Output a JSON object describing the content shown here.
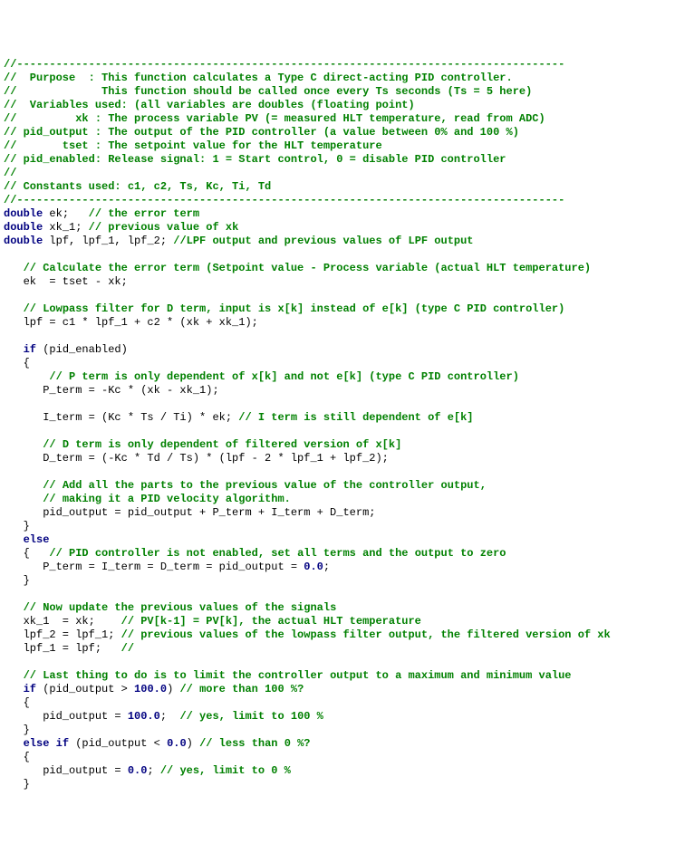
{
  "lines": [
    [
      {
        "cls": "c",
        "t": "//------------------------------------------------------------------------------------"
      }
    ],
    [
      {
        "cls": "c",
        "t": "//  Purpose  : This function calculates a Type C direct-acting PID controller."
      }
    ],
    [
      {
        "cls": "c",
        "t": "//             This function should be called once every Ts seconds (Ts = 5 here)"
      }
    ],
    [
      {
        "cls": "c",
        "t": "//  Variables used: (all variables are doubles (floating point)"
      }
    ],
    [
      {
        "cls": "c",
        "t": "//         xk : The process variable PV (= measured HLT temperature, read from ADC)"
      }
    ],
    [
      {
        "cls": "c",
        "t": "// pid_output : The output of the PID controller (a value between 0% and 100 %)"
      }
    ],
    [
      {
        "cls": "c",
        "t": "//       tset : The setpoint value for the HLT temperature"
      }
    ],
    [
      {
        "cls": "c",
        "t": "// pid_enabled: Release signal: 1 = Start control, 0 = disable PID controller"
      }
    ],
    [
      {
        "cls": "c",
        "t": "//"
      }
    ],
    [
      {
        "cls": "c",
        "t": "// Constants used: c1, c2, Ts, Kc, Ti, Td"
      }
    ],
    [
      {
        "cls": "c",
        "t": "//------------------------------------------------------------------------------------"
      }
    ],
    [
      {
        "cls": "kw",
        "t": "double"
      },
      {
        "cls": "plain",
        "t": " ek;   "
      },
      {
        "cls": "c",
        "t": "// the error term"
      }
    ],
    [
      {
        "cls": "kw",
        "t": "double"
      },
      {
        "cls": "plain",
        "t": " xk_1; "
      },
      {
        "cls": "c",
        "t": "// previous value of xk"
      }
    ],
    [
      {
        "cls": "kw",
        "t": "double"
      },
      {
        "cls": "plain",
        "t": " lpf, lpf_1, lpf_2; "
      },
      {
        "cls": "c",
        "t": "//LPF output and previous values of LPF output"
      }
    ],
    [
      {
        "cls": "plain",
        "t": ""
      }
    ],
    [
      {
        "cls": "plain",
        "t": "   "
      },
      {
        "cls": "c",
        "t": "// Calculate the error term (Setpoint value - Process variable (actual HLT temperature)"
      }
    ],
    [
      {
        "cls": "plain",
        "t": "   ek  = tset - xk;"
      }
    ],
    [
      {
        "cls": "plain",
        "t": ""
      }
    ],
    [
      {
        "cls": "plain",
        "t": "   "
      },
      {
        "cls": "c",
        "t": "// Lowpass filter for D term, input is x[k] instead of e[k] (type C PID controller)"
      }
    ],
    [
      {
        "cls": "plain",
        "t": "   lpf = c1 * lpf_1 + c2 * (xk + xk_1);"
      }
    ],
    [
      {
        "cls": "plain",
        "t": ""
      }
    ],
    [
      {
        "cls": "plain",
        "t": "   "
      },
      {
        "cls": "kw",
        "t": "if"
      },
      {
        "cls": "plain",
        "t": " (pid_enabled)"
      }
    ],
    [
      {
        "cls": "plain",
        "t": "   {"
      }
    ],
    [
      {
        "cls": "plain",
        "t": "       "
      },
      {
        "cls": "c",
        "t": "// P term is only dependent of x[k] and not e[k] (type C PID controller)"
      }
    ],
    [
      {
        "cls": "plain",
        "t": "      P_term = -Kc * (xk - xk_1);"
      }
    ],
    [
      {
        "cls": "plain",
        "t": ""
      }
    ],
    [
      {
        "cls": "plain",
        "t": "      I_term = (Kc * Ts / Ti) * ek; "
      },
      {
        "cls": "c",
        "t": "// I term is still dependent of e[k]"
      }
    ],
    [
      {
        "cls": "plain",
        "t": ""
      }
    ],
    [
      {
        "cls": "plain",
        "t": "      "
      },
      {
        "cls": "c",
        "t": "// D term is only dependent of filtered version of x[k]"
      }
    ],
    [
      {
        "cls": "plain",
        "t": "      D_term = (-Kc * Td / Ts) * (lpf - 2 * lpf_1 + lpf_2);"
      }
    ],
    [
      {
        "cls": "plain",
        "t": ""
      }
    ],
    [
      {
        "cls": "plain",
        "t": "      "
      },
      {
        "cls": "c",
        "t": "// Add all the parts to the previous value of the controller output,"
      }
    ],
    [
      {
        "cls": "plain",
        "t": "      "
      },
      {
        "cls": "c",
        "t": "// making it a PID velocity algorithm."
      }
    ],
    [
      {
        "cls": "plain",
        "t": "      pid_output = pid_output + P_term + I_term + D_term;"
      }
    ],
    [
      {
        "cls": "plain",
        "t": "   }"
      }
    ],
    [
      {
        "cls": "plain",
        "t": "   "
      },
      {
        "cls": "kw",
        "t": "else"
      }
    ],
    [
      {
        "cls": "plain",
        "t": "   {   "
      },
      {
        "cls": "c",
        "t": "// PID controller is not enabled, set all terms and the output to zero"
      }
    ],
    [
      {
        "cls": "plain",
        "t": "      P_term = I_term = D_term = pid_output = "
      },
      {
        "cls": "kw",
        "t": "0.0"
      },
      {
        "cls": "plain",
        "t": ";"
      }
    ],
    [
      {
        "cls": "plain",
        "t": "   }"
      }
    ],
    [
      {
        "cls": "plain",
        "t": ""
      }
    ],
    [
      {
        "cls": "plain",
        "t": "   "
      },
      {
        "cls": "c",
        "t": "// Now update the previous values of the signals"
      }
    ],
    [
      {
        "cls": "plain",
        "t": "   xk_1  = xk;    "
      },
      {
        "cls": "c",
        "t": "// PV[k-1] = PV[k], the actual HLT temperature"
      }
    ],
    [
      {
        "cls": "plain",
        "t": "   lpf_2 = lpf_1; "
      },
      {
        "cls": "c",
        "t": "// previous values of the lowpass filter output, the filtered version of xk"
      }
    ],
    [
      {
        "cls": "plain",
        "t": "   lpf_1 = lpf;   "
      },
      {
        "cls": "c",
        "t": "//"
      }
    ],
    [
      {
        "cls": "plain",
        "t": ""
      }
    ],
    [
      {
        "cls": "plain",
        "t": "   "
      },
      {
        "cls": "c",
        "t": "// Last thing to do is to limit the controller output to a maximum and minimum value"
      }
    ],
    [
      {
        "cls": "plain",
        "t": "   "
      },
      {
        "cls": "kw",
        "t": "if"
      },
      {
        "cls": "plain",
        "t": " (pid_output > "
      },
      {
        "cls": "kw",
        "t": "100.0"
      },
      {
        "cls": "plain",
        "t": ") "
      },
      {
        "cls": "c",
        "t": "// more than 100 %?"
      }
    ],
    [
      {
        "cls": "plain",
        "t": "   {"
      }
    ],
    [
      {
        "cls": "plain",
        "t": "      pid_output = "
      },
      {
        "cls": "kw",
        "t": "100.0"
      },
      {
        "cls": "plain",
        "t": ";  "
      },
      {
        "cls": "c",
        "t": "// yes, limit to 100 %"
      }
    ],
    [
      {
        "cls": "plain",
        "t": "   }"
      }
    ],
    [
      {
        "cls": "plain",
        "t": "   "
      },
      {
        "cls": "kw",
        "t": "else"
      },
      {
        "cls": "plain",
        "t": " "
      },
      {
        "cls": "kw",
        "t": "if"
      },
      {
        "cls": "plain",
        "t": " (pid_output < "
      },
      {
        "cls": "kw",
        "t": "0.0"
      },
      {
        "cls": "plain",
        "t": ") "
      },
      {
        "cls": "c",
        "t": "// less than 0 %?"
      }
    ],
    [
      {
        "cls": "plain",
        "t": "   {"
      }
    ],
    [
      {
        "cls": "plain",
        "t": "      pid_output = "
      },
      {
        "cls": "kw",
        "t": "0.0"
      },
      {
        "cls": "plain",
        "t": "; "
      },
      {
        "cls": "c",
        "t": "// yes, limit to 0 %"
      }
    ],
    [
      {
        "cls": "plain",
        "t": "   }"
      }
    ]
  ]
}
